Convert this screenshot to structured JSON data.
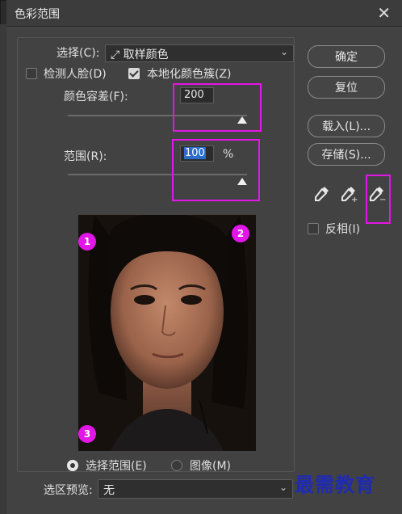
{
  "window": {
    "title": "色彩范围"
  },
  "select": {
    "label": "选择(C):",
    "value": "取样颜色"
  },
  "checkboxes": {
    "detect_faces": "检测人脸(D)",
    "localized": "本地化颜色簇(Z)",
    "invert": "反相(I)"
  },
  "fuzziness": {
    "label": "颜色容差(F):",
    "value": "200"
  },
  "range": {
    "label": "范围(R):",
    "value": "100",
    "unit": "%"
  },
  "badges": [
    "1",
    "2",
    "3"
  ],
  "radio": {
    "selection": "选择范围(E)",
    "image": "图像(M)"
  },
  "preview_bar": {
    "label": "选区预览:",
    "value": "无"
  },
  "buttons": {
    "ok": "确定",
    "reset": "复位",
    "load": "载入(L)...",
    "save": "存储(S)..."
  },
  "watermark": "最需教育"
}
